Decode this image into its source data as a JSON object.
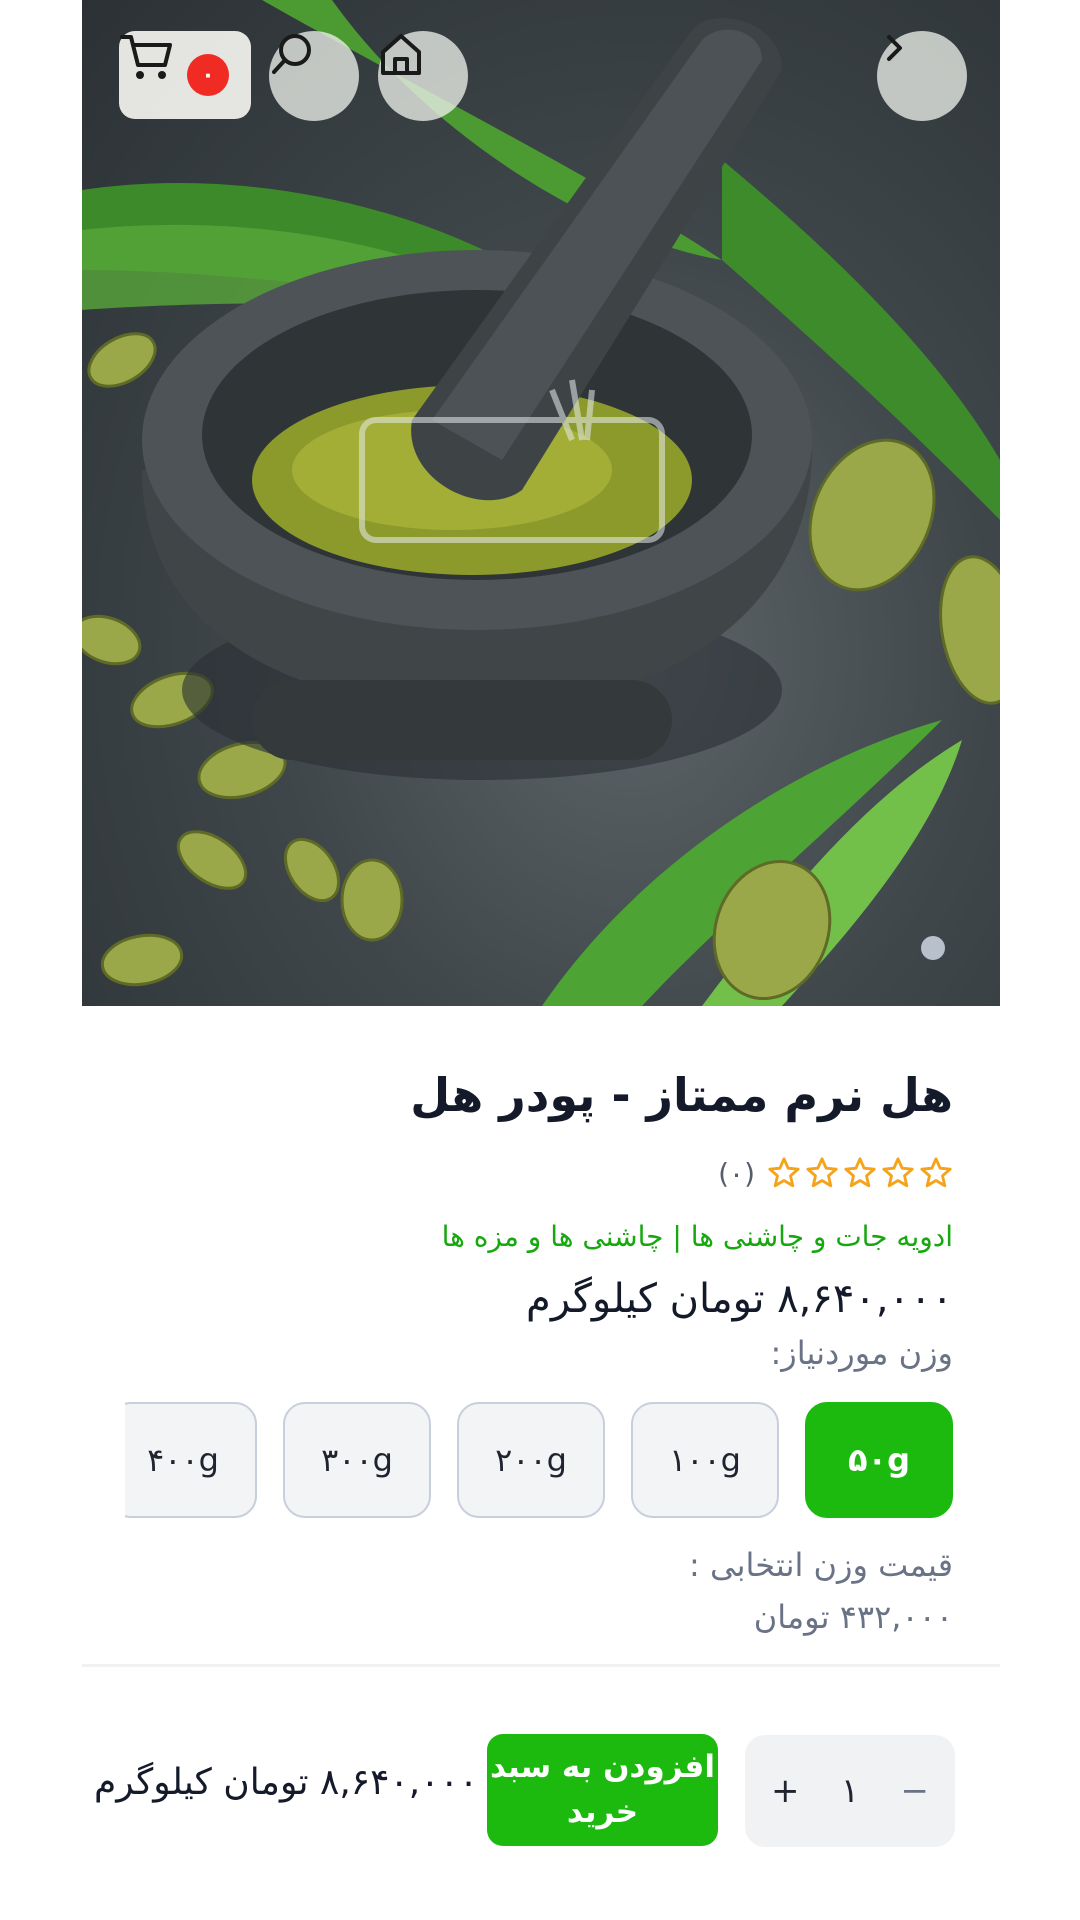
{
  "header": {
    "cart_count": "۰",
    "icons": [
      "cart-icon",
      "search-icon",
      "home-icon",
      "chevron-right-icon"
    ]
  },
  "product": {
    "title": "هل نرم ممتاز - پودر هل",
    "rating_count": "(۰)",
    "rating_value": 0,
    "rating_max": 5,
    "categories": "ادویه جات و چاشنی ها | چاشنی ها و مزه ها",
    "price": "۸,۶۴۰,۰۰۰ تومان کیلوگرم",
    "weight_label": "وزن موردنیاز:",
    "weights": [
      "۵۰g",
      "۱۰۰g",
      "۲۰۰g",
      "۳۰۰g",
      "۴۰۰g"
    ],
    "selected_weight": "۵۰g",
    "selected_price_label": "قیمت وزن انتخابی :",
    "selected_price": "۴۳۲,۰۰۰ تومان"
  },
  "bottom_bar": {
    "quantity": "۱",
    "plus": "+",
    "minus": "−",
    "add_to_cart": "افزودن به سبد خرید",
    "price": "۸,۶۴۰,۰۰۰ تومان کیلوگرم"
  },
  "colors": {
    "accent_green": "#1cba0e",
    "category_green": "#17a70f",
    "badge_red": "#ef2b24",
    "star_orange": "#f4a31a"
  }
}
